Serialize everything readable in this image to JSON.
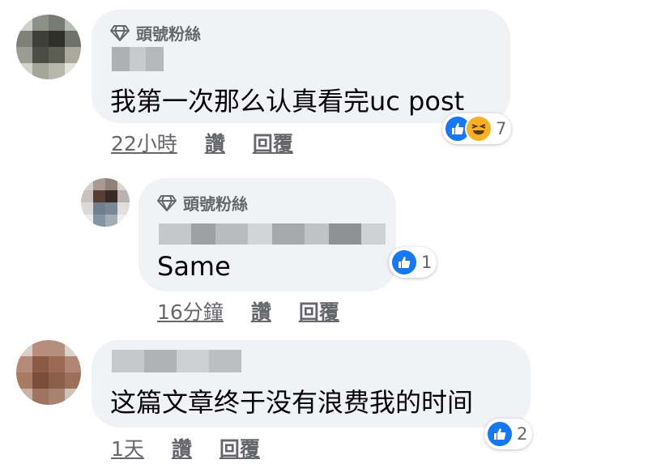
{
  "comments": [
    {
      "badge": "頭號粉絲",
      "text": "我第一次那么认真看完uc post",
      "time": "22小時",
      "like_label": "讚",
      "reply_label": "回覆",
      "reaction_count": "7",
      "reactions": [
        "like",
        "haha"
      ]
    },
    {
      "badge": "頭號粉絲",
      "text": "Same",
      "time": "16分鐘",
      "like_label": "讚",
      "reply_label": "回覆",
      "reaction_count": "1",
      "reactions": [
        "like"
      ]
    },
    {
      "badge": "",
      "text": "这篇文章终于没有浪费我的时间",
      "time": "1天",
      "like_label": "讚",
      "reply_label": "回覆",
      "reaction_count": "2",
      "reactions": [
        "like"
      ]
    }
  ],
  "colors": {
    "bubble": "#f0f2f5",
    "meta_text": "#65676b",
    "like_blue": "#1877f2",
    "haha_yellow": "#f7b125"
  },
  "icons": [
    "diamond-icon",
    "thumbs-up-icon",
    "haha-emoji-icon"
  ]
}
